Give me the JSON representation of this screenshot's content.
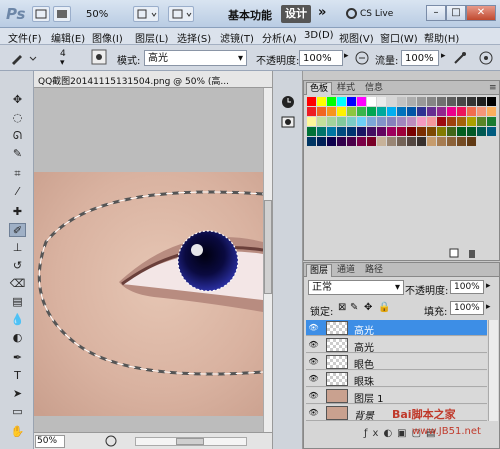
{
  "app": {
    "logo": "Ps"
  },
  "titlebar": {
    "zoom": "50%",
    "workspace_basic": "基本功能",
    "workspace_design": "设计",
    "more": "»",
    "cslive": "CS Live"
  },
  "menu": [
    "文件(F)",
    "编辑(E)",
    "图像(I)",
    "图层(L)",
    "选择(S)",
    "滤镜(T)",
    "分析(A)",
    "3D(D)",
    "视图(V)",
    "窗口(W)",
    "帮助(H)"
  ],
  "options": {
    "brush_size": "4",
    "mode_label": "模式:",
    "mode_value": "高光",
    "opacity_label": "不透明度:",
    "opacity_value": "100%",
    "flow_label": "流量:",
    "flow_value": "100%"
  },
  "document": {
    "tab_title": "QQ截图20141115131504.png @ 50% (高...",
    "zoom": "50%"
  },
  "swatch_tabs": [
    "色板",
    "样式",
    "信息"
  ],
  "swatch_colors": {
    "row1": [
      "#ff0000",
      "#ffff00",
      "#00ff00",
      "#00ffff",
      "#0000ff",
      "#ff00ff",
      "#ffffff",
      "#ebebeb",
      "#d6d6d6",
      "#c2c2c2",
      "#adadad",
      "#999999",
      "#858585",
      "#707070",
      "#5c5c5c",
      "#474747",
      "#333333",
      "#1f1f1f",
      "#000000"
    ],
    "row2": [
      "#ee1d24",
      "#f16522",
      "#f7941d",
      "#fff100",
      "#8dc63f",
      "#39b54a",
      "#00a651",
      "#00a99d",
      "#00aeef",
      "#0072bc",
      "#0054a6",
      "#2e3192",
      "#662d91",
      "#92278f",
      "#ec008c",
      "#ed145b",
      "#f26c4f",
      "#f69679",
      "#fbaf5d"
    ],
    "row3": [
      "#fff799",
      "#c4df9b",
      "#a3d39c",
      "#82ca9d",
      "#7bcdc8",
      "#6dcff6",
      "#7da7d9",
      "#8393ca",
      "#8781bd",
      "#a187be",
      "#bd8cbf",
      "#f49ac1",
      "#f5989d",
      "#9e0b0f",
      "#a0410d",
      "#a3620a",
      "#aba000",
      "#598527",
      "#197b30"
    ],
    "row4": [
      "#007236",
      "#00746b",
      "#0076a3",
      "#004b80",
      "#003471",
      "#1b1464",
      "#440e62",
      "#630460",
      "#9e005d",
      "#9e0039",
      "#790000",
      "#7b2e00",
      "#7d4900",
      "#827b00",
      "#406618",
      "#005e20",
      "#005826",
      "#005952",
      "#005b7f"
    ],
    "row5": [
      "#003663",
      "#002157",
      "#0d004c",
      "#32004b",
      "#4b0049",
      "#7b0046",
      "#7a0026",
      "#c7b299",
      "#998675",
      "#736357",
      "#534741",
      "#37302d",
      "#c69c6d",
      "#a67c52",
      "#8c6239",
      "#754c24",
      "#603913"
    ]
  },
  "layers": {
    "tabs": [
      "图层",
      "通道",
      "路径"
    ],
    "blend_mode": "正常",
    "opacity_label": "不透明度:",
    "opacity_value": "100%",
    "lock_label": "锁定:",
    "fill_label": "填充:",
    "fill_value": "100%",
    "items": [
      {
        "name": "高光",
        "selected": true
      },
      {
        "name": "高光",
        "selected": false
      },
      {
        "name": "眼色",
        "selected": false
      },
      {
        "name": "眼珠",
        "selected": false
      },
      {
        "name": "图层 1",
        "selected": false
      },
      {
        "name": "背景",
        "selected": false
      }
    ]
  },
  "watermark": {
    "line1": "Bai脚本之家",
    "line2": "www.JB51.net"
  }
}
